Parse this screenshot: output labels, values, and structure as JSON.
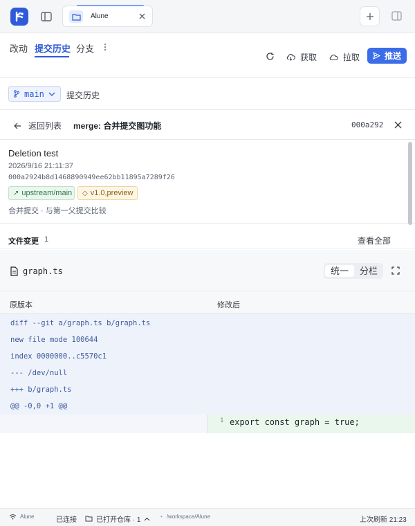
{
  "titlebar": {
    "tab_label": "Alune"
  },
  "toolbar": {
    "tabs": [
      {
        "label": "改动",
        "active": false
      },
      {
        "label": "提交历史",
        "active": true
      },
      {
        "label": "分支",
        "active": false
      }
    ],
    "fetch_label": "获取",
    "pull_label": "拉取",
    "push_label": "推送"
  },
  "branch": {
    "name": "main",
    "breadcrumb": "提交历史"
  },
  "detail": {
    "back_label": "返回列表",
    "title": "merge: 合并提交图功能",
    "short_hash": "000a292"
  },
  "commit": {
    "message": "Deletion test",
    "date": "2026/9/16 21:11:37",
    "hash": "000a2924b8d1468890949ee62bb11895a7289f26",
    "refs": [
      {
        "label": "upstream/main",
        "kind": "remote"
      },
      {
        "label": "v1.0,preview",
        "kind": "tag"
      }
    ],
    "merge_note": "合并提交 · 与第一父提交比较"
  },
  "files": {
    "label": "文件变更",
    "count": "1",
    "view_all": "查看全部",
    "file_name": "graph.ts",
    "mode_unified": "统一",
    "mode_split": "分栏"
  },
  "diff": {
    "left_label": "原版本",
    "right_label": "修改后",
    "meta_lines": [
      "diff --git a/graph.ts b/graph.ts",
      "new file mode 100644",
      "index 0000000..c5570c1",
      "--- /dev/null",
      "+++ b/graph.ts",
      "@@ -0,0 +1 @@"
    ],
    "added_line_no": "1",
    "added_line": "export const graph = true;"
  },
  "statusbar": {
    "app": "Alune",
    "connection": "已连接",
    "repos": "已打开仓库 · 1",
    "path": "/workspace/Alune",
    "last_refresh": "上次刷新 21:23"
  },
  "colors": {
    "accent": "#2f5bd8",
    "push_button": "#3b6de8",
    "added_line_bg": "#e9f7ec",
    "meta_bg": "#eef2fb"
  },
  "icons": [
    "app-logo-icon",
    "sidebar-toggle-icon",
    "folder-icon",
    "close-icon",
    "plus-icon",
    "panel-icon",
    "more-vertical-icon",
    "refresh-icon",
    "cloud-download-icon",
    "cloud-icon",
    "send-icon",
    "branch-icon",
    "chevron-down-icon",
    "arrow-left-icon",
    "file-icon",
    "expand-icon",
    "wifi-icon",
    "folder-open-icon",
    "chevron-up-icon"
  ]
}
